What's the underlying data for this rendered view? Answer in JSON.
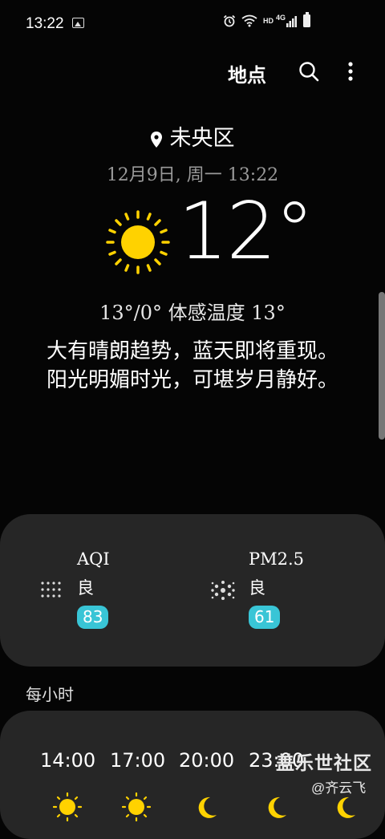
{
  "status_bar": {
    "time": "13:22",
    "hd_label": "HD",
    "net_label": "4G"
  },
  "toolbar": {
    "locations_label": "地点"
  },
  "weather": {
    "location": "未央区",
    "datetime": "12月9日, 周一 13:22",
    "temperature": "12°",
    "range_feels": "13°/0° 体感温度 13°",
    "description": "大有晴朗趋势，蓝天即将重现。阳光明媚时光，可堪岁月静好。",
    "condition_icon": "sun-icon"
  },
  "air_quality": {
    "aqi": {
      "title": "AQI",
      "level": "良",
      "value": "83"
    },
    "pm25": {
      "title": "PM2.5",
      "level": "良",
      "value": "61"
    },
    "badge_color": "#39c5d6"
  },
  "hourly": {
    "label": "每小时",
    "hours": [
      {
        "time": "14:00",
        "icon": "sun-icon"
      },
      {
        "time": "17:00",
        "icon": "sun-icon"
      },
      {
        "time": "20:00",
        "icon": "moon-icon"
      },
      {
        "time": "23:00",
        "icon": "moon-icon"
      },
      {
        "time": "",
        "icon": "moon-icon"
      }
    ]
  },
  "watermark": {
    "main": "盖乐世社区",
    "sub": "@齐云飞"
  }
}
